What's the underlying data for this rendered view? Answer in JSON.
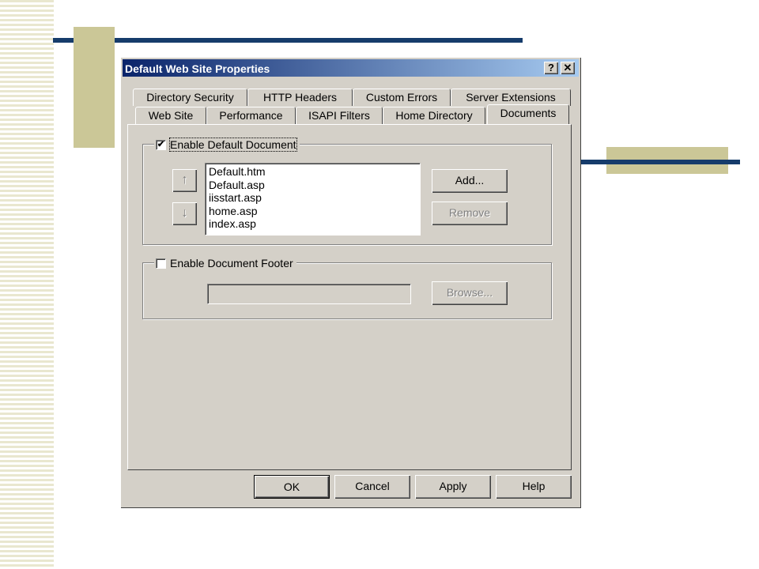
{
  "dialog": {
    "title": "Default Web Site Properties",
    "help_glyph": "?",
    "close_glyph": "✕"
  },
  "tabs_back": [
    {
      "label": "Directory Security"
    },
    {
      "label": "HTTP Headers"
    },
    {
      "label": "Custom Errors"
    },
    {
      "label": "Server Extensions"
    }
  ],
  "tabs_front": [
    {
      "label": "Web Site"
    },
    {
      "label": "Performance"
    },
    {
      "label": "ISAPI Filters"
    },
    {
      "label": "Home Directory"
    },
    {
      "label": "Documents",
      "active": true
    }
  ],
  "default_doc": {
    "checkbox_label": "Enable Default Document",
    "checked": true,
    "check_glyph": "✔",
    "up_glyph": "↑",
    "down_glyph": "↓",
    "documents": [
      "Default.htm",
      "Default.asp",
      "iisstart.asp",
      "home.asp",
      "index.asp"
    ],
    "add_label": "Add...",
    "remove_label": "Remove"
  },
  "footer": {
    "checkbox_label": "Enable Document Footer",
    "checked": false,
    "path_value": "",
    "browse_label": "Browse..."
  },
  "buttons": {
    "ok": "OK",
    "cancel": "Cancel",
    "apply": "Apply",
    "help": "Help"
  },
  "colors": {
    "title_gradient_start": "#0a246a",
    "title_gradient_end": "#a6caf0",
    "dialog_face": "#d4d0c8",
    "slide_accent_navy": "#163c6b",
    "slide_accent_khaki": "#cbc797"
  }
}
